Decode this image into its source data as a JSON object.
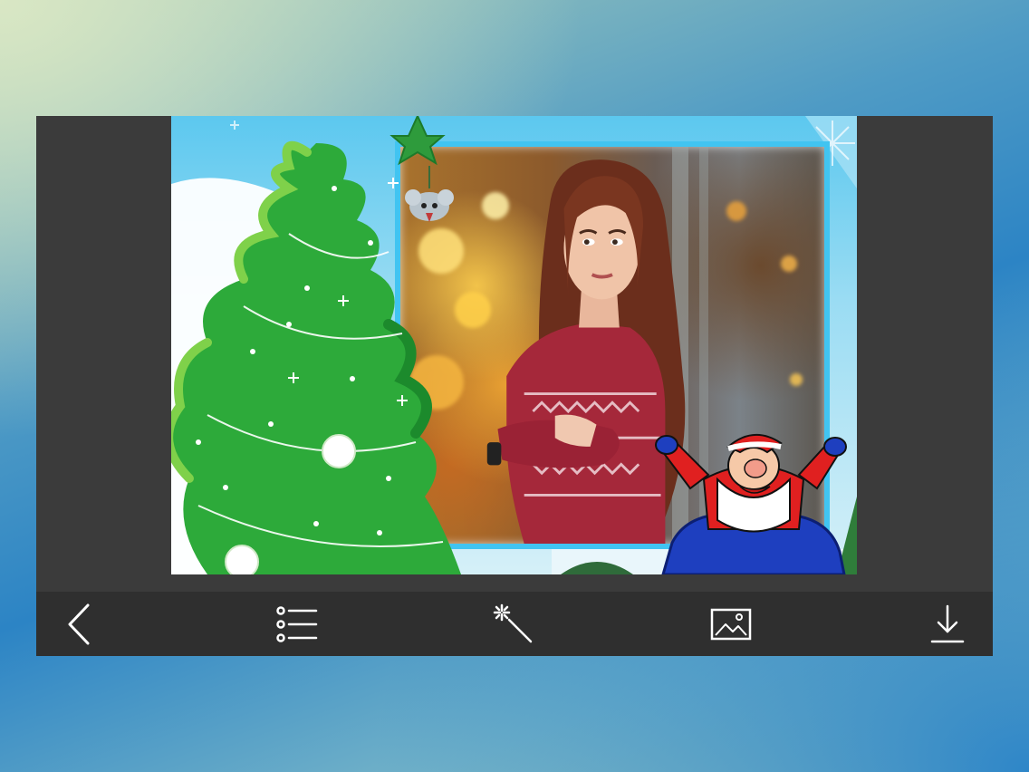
{
  "app": {
    "background_colors": {
      "top_left": "#d9e7c4",
      "center": "#2c84c5",
      "bottom": "#a8d0c0"
    },
    "window_color": "#393939",
    "toolbar_color": "#2f2f2f",
    "icon_color": "#ffffff"
  },
  "canvas": {
    "frame_theme": "christmas-tree-santa",
    "frame_border_color": "#41c4f1",
    "sticker_top": "hanging-mouse",
    "sticker_bottom": "santa-with-sack"
  },
  "toolbar": {
    "buttons": [
      {
        "icon": "back-chevron-icon"
      },
      {
        "icon": "frame-list-icon"
      },
      {
        "icon": "magic-wand-icon"
      },
      {
        "icon": "gallery-image-icon"
      },
      {
        "icon": "download-icon"
      }
    ]
  }
}
